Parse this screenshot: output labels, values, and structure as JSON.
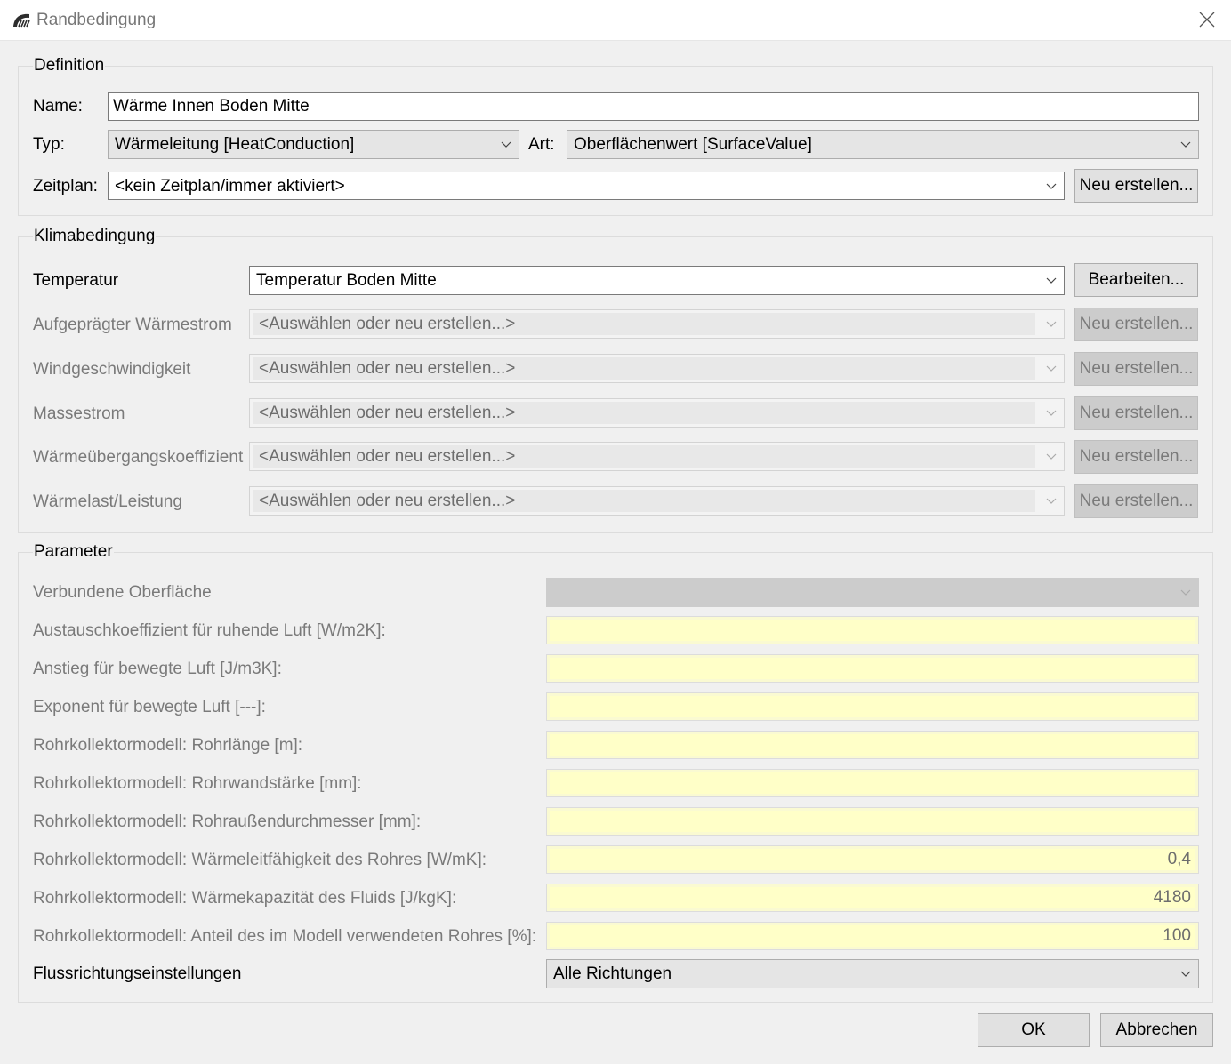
{
  "window": {
    "title": "Randbedingung",
    "app_icon": "dome-app-icon",
    "close_icon": "close-icon"
  },
  "definition": {
    "group_title": "Definition",
    "name_label": "Name:",
    "name_value": "Wärme Innen Boden Mitte",
    "typ_label": "Typ:",
    "typ_value": "Wärmeleitung [HeatConduction]",
    "art_label": "Art:",
    "art_value": "Oberflächenwert [SurfaceValue]",
    "zeitplan_label": "Zeitplan:",
    "zeitplan_value": "<kein Zeitplan/immer aktiviert>",
    "zeitplan_button": "Neu erstellen..."
  },
  "klima": {
    "group_title": "Klimabedingung",
    "rows": [
      {
        "label": "Temperatur",
        "value": "Temperatur Boden Mitte",
        "button": "Bearbeiten...",
        "enabled": true
      },
      {
        "label": "Aufgeprägter Wärmestrom",
        "value": "<Auswählen oder neu erstellen...>",
        "button": "Neu erstellen...",
        "enabled": false
      },
      {
        "label": "Windgeschwindigkeit",
        "value": "<Auswählen oder neu erstellen...>",
        "button": "Neu erstellen...",
        "enabled": false
      },
      {
        "label": "Massestrom",
        "value": "<Auswählen oder neu erstellen...>",
        "button": "Neu erstellen...",
        "enabled": false
      },
      {
        "label": "Wärmeübergangskoeffizient",
        "value": "<Auswählen oder neu erstellen...>",
        "button": "Neu erstellen...",
        "enabled": false
      },
      {
        "label": "Wärmelast/Leistung",
        "value": "<Auswählen oder neu erstellen...>",
        "button": "Neu erstellen...",
        "enabled": false
      }
    ]
  },
  "parameter": {
    "group_title": "Parameter",
    "surface_label": "Verbundene Oberfläche",
    "surface_value": "",
    "fields": [
      {
        "label": "Austauschkoeffizient für ruhende Luft [W/m2K]:",
        "value": ""
      },
      {
        "label": "Anstieg für bewegte Luft [J/m3K]:",
        "value": ""
      },
      {
        "label": "Exponent für bewegte Luft [---]:",
        "value": ""
      },
      {
        "label": "Rohrkollektormodell: Rohrlänge [m]:",
        "value": ""
      },
      {
        "label": "Rohrkollektormodell: Rohrwandstärke [mm]:",
        "value": ""
      },
      {
        "label": "Rohrkollektormodell: Rohraußendurchmesser [mm]:",
        "value": ""
      },
      {
        "label": "Rohrkollektormodell: Wärmeleitfähigkeit des Rohres [W/mK]:",
        "value": "0,4"
      },
      {
        "label": "Rohrkollektormodell: Wärmekapazität des Fluids [J/kgK]:",
        "value": "4180"
      },
      {
        "label": "Rohrkollektormodell: Anteil des im Modell verwendeten Rohres [%]:",
        "value": "100"
      }
    ],
    "flow_label": "Flussrichtungseinstellungen",
    "flow_value": "Alle Richtungen"
  },
  "buttons": {
    "ok": "OK",
    "cancel": "Abbrechen"
  },
  "colors": {
    "field_bg": "#ffffc8",
    "window_bg": "#f0f0f0",
    "button_bg": "#e1e1e1"
  }
}
